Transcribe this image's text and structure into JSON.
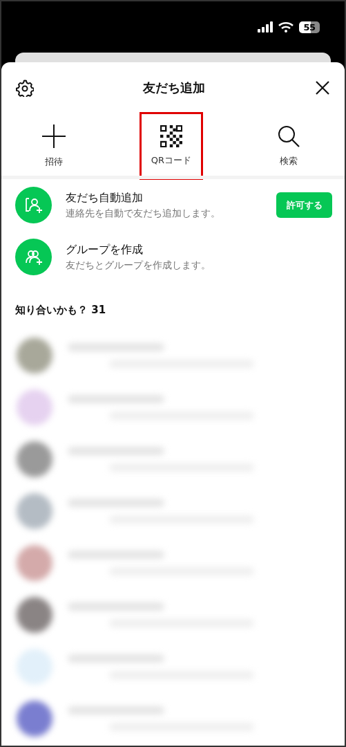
{
  "status_bar": {
    "battery": "55"
  },
  "header": {
    "title": "友だち追加"
  },
  "actions": [
    {
      "kind": "plus",
      "label": "招待",
      "highlighted": false
    },
    {
      "kind": "qr",
      "label": "QRコード",
      "highlighted": true
    },
    {
      "kind": "search",
      "label": "検索",
      "highlighted": false
    }
  ],
  "options": [
    {
      "kind": "auto",
      "title": "友だち自動追加",
      "subtitle": "連絡先を自動で友だち追加します。",
      "button": "許可する"
    },
    {
      "kind": "group",
      "title": "グループを作成",
      "subtitle": "友だちとグループを作成します。"
    }
  ],
  "suggestions": {
    "title": "知り合いかも？ 31",
    "rows": [
      {
        "color": "#a8a89a"
      },
      {
        "color": "#e6d2f0"
      },
      {
        "color": "#9a9a9a"
      },
      {
        "color": "#b4bcc4"
      },
      {
        "color": "#d4aaaa"
      },
      {
        "color": "#8a8484"
      },
      {
        "color": "#e2f0fa"
      },
      {
        "color": "#7a7ed0"
      }
    ]
  }
}
